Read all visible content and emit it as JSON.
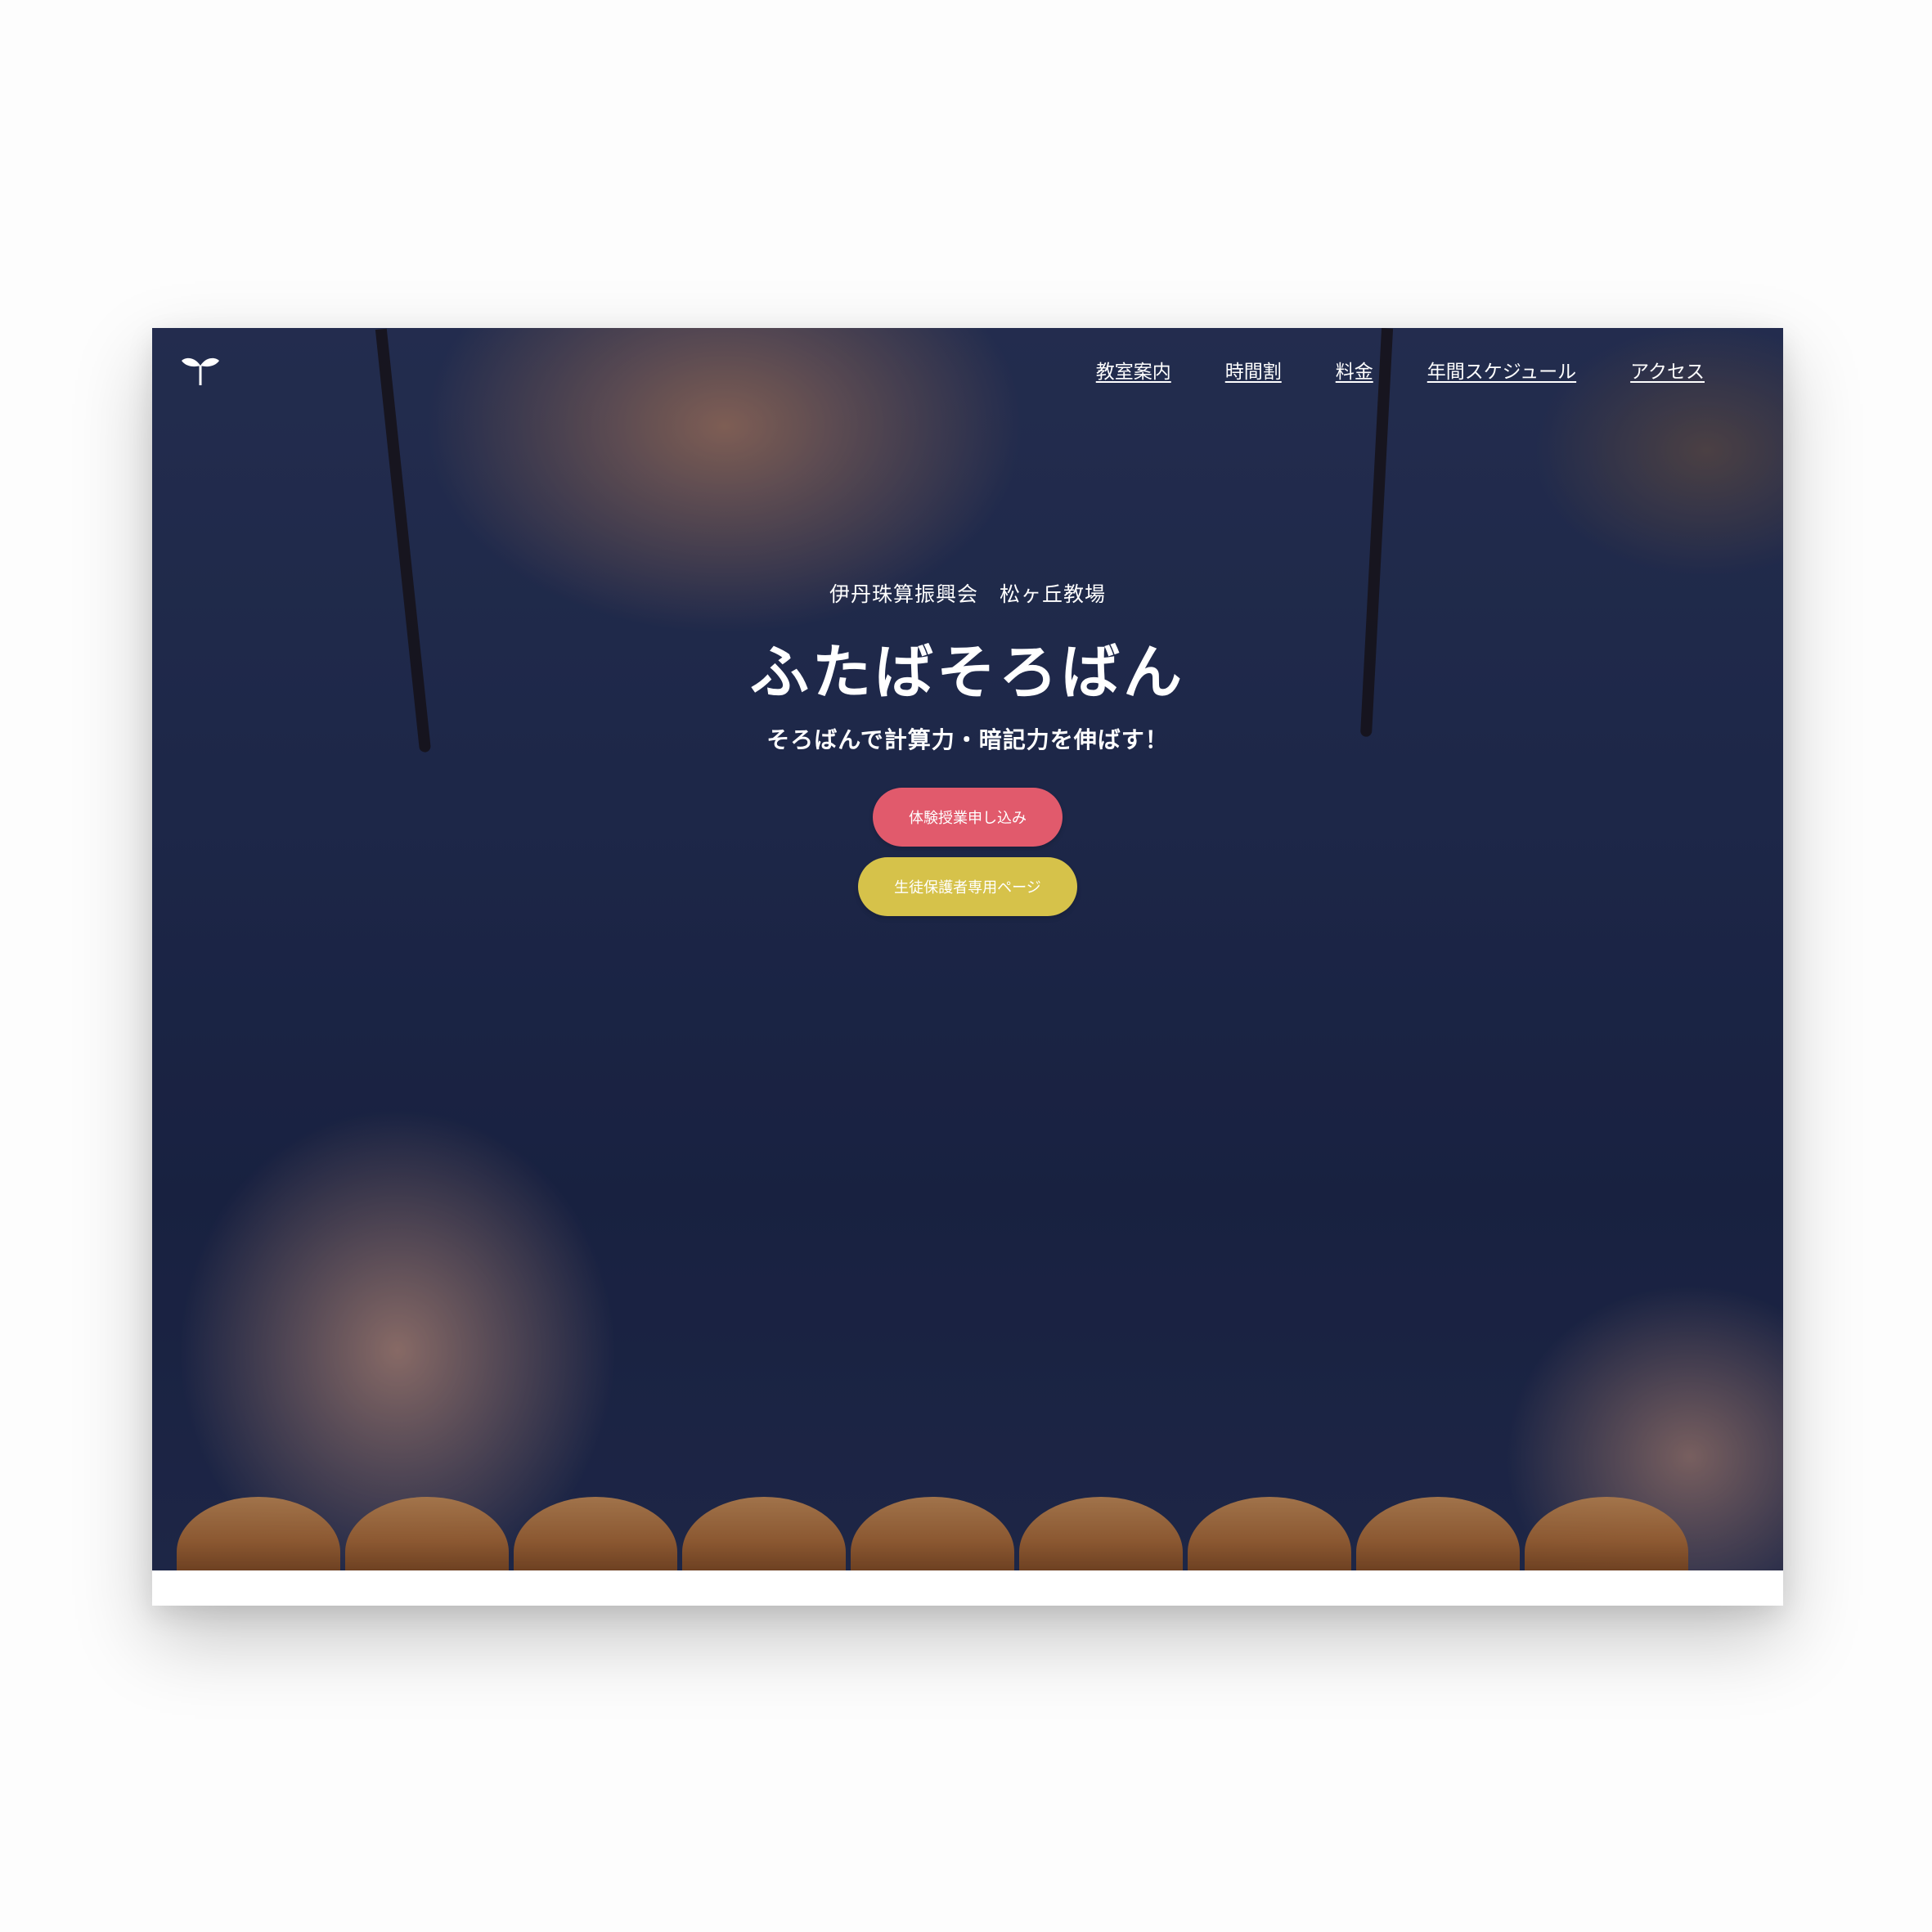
{
  "header": {
    "logo_icon": "sprout-icon"
  },
  "nav": {
    "items": [
      "教室案内",
      "時間割",
      "料金",
      "年間スケジュール",
      "アクセス"
    ]
  },
  "hero": {
    "subtitle": "伊丹珠算振興会　松ヶ丘教場",
    "title": "ふたばそろばん",
    "tagline": "そろばんで計算力・暗記力を伸ばす！",
    "buttons": {
      "trial_label": "体験授業申し込み",
      "parent_label": "生徒保護者専用ページ"
    }
  },
  "colors": {
    "trial_button": "#e15a6c",
    "parent_button": "#d6c24a",
    "hero_overlay": "#1e2a50"
  }
}
